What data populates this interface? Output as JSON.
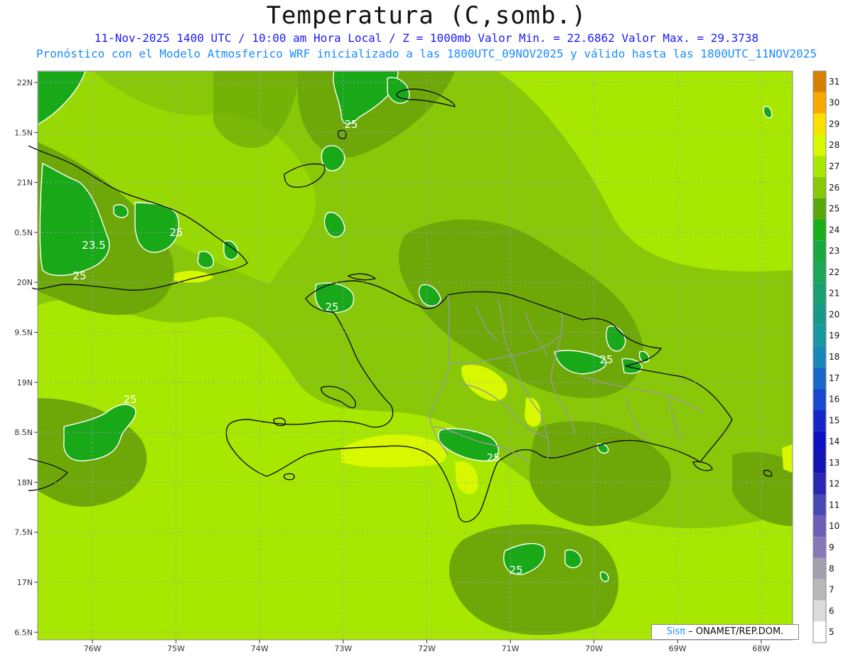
{
  "header": {
    "title": "Temperatura (C,somb.)",
    "subtitle1": "11-Nov-2025 1400 UTC / 10:00 am Hora Local / Z = 1000mb  Valor Min. = 22.6862  Valor Max. = 29.3738",
    "subtitle2": "Pronóstico con el Modelo Atmosferico WRF inicializado a las 1800UTC_09NOV2025 y válido hasta las  1800UTC_11NOV2025"
  },
  "map": {
    "lat_labels": [
      "22N",
      "1.5N",
      "21N",
      "0.5N",
      "20N",
      "9.5N",
      "19N",
      "8.5N",
      "18N",
      "7.5N",
      "17N",
      "6.5N"
    ],
    "lon_labels": [
      "76W",
      "75W",
      "74W",
      "73W",
      "72W",
      "71W",
      "70W",
      "69W",
      "68W"
    ],
    "contour_labels": [
      "25",
      "25",
      "23.5",
      "25",
      "25",
      "25",
      "25",
      "25",
      "25"
    ]
  },
  "colorbar": {
    "levels": [
      5,
      6,
      7,
      8,
      9,
      10,
      11,
      12,
      13,
      14,
      15,
      16,
      17,
      18,
      19,
      20,
      21,
      22,
      23,
      24,
      25,
      26,
      27,
      28,
      29,
      30,
      31
    ],
    "colors": [
      "#ffffff",
      "#dcdcdc",
      "#b8b8b8",
      "#a0a0b0",
      "#8878b8",
      "#6c60b4",
      "#4848b4",
      "#2828b0",
      "#1414b0",
      "#1010c0",
      "#1428c8",
      "#1848d0",
      "#1868c8",
      "#1888b8",
      "#1898a0",
      "#189888",
      "#18a070",
      "#18a858",
      "#18a840",
      "#18b018",
      "#58a808",
      "#88c808",
      "#a8e800",
      "#d8f800",
      "#f8e000",
      "#f8a800",
      "#d88000"
    ]
  },
  "credit": {
    "brand": "Sisπ",
    "org": "– ONAMET/REP.DOM."
  }
}
